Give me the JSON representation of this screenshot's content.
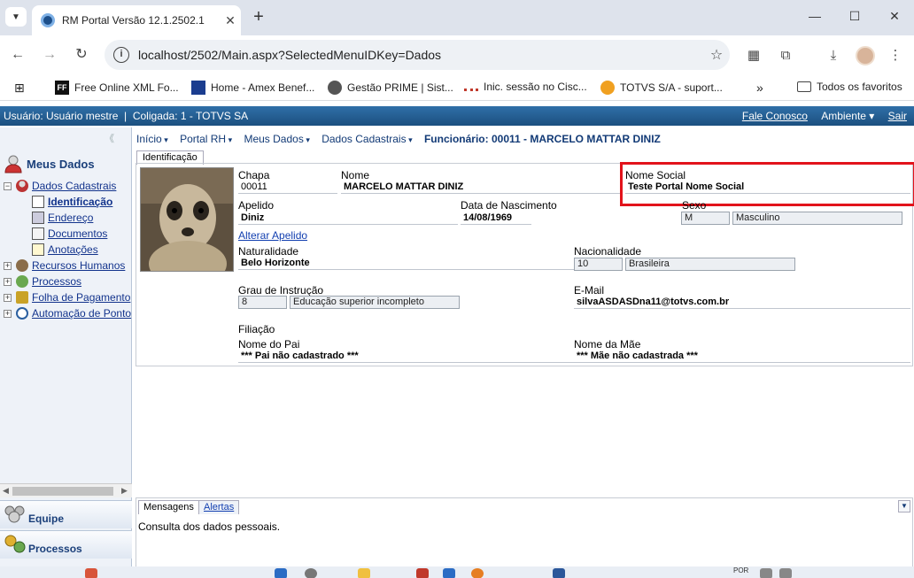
{
  "browser": {
    "tab_title": "RM Portal Versão 12.1.2502.1",
    "tab_close": "✕",
    "new_tab": "+",
    "window_controls": {
      "minimize": "—",
      "maximize": "☐",
      "close": "✕"
    },
    "nav": {
      "back": "←",
      "forward": "→",
      "reload": "↻"
    },
    "url": "localhost/2502/Main.aspx?SelectedMenuIDKey=Dados",
    "bookmarks": [
      {
        "label": "Free Online XML Fo...",
        "icon": "ff-icon"
      },
      {
        "label": "Home - Amex Benef...",
        "icon": "amex-icon"
      },
      {
        "label": "Gestão PRIME | Sist...",
        "icon": "prime-icon"
      },
      {
        "label": "Inic. sessão no Cisc...",
        "icon": "cisco-icon"
      },
      {
        "label": "TOTVS S/A - suport...",
        "icon": "totvs-icon"
      }
    ],
    "bookmarks_overflow": "»",
    "all_bookmarks": "Todos os favoritos"
  },
  "portal": {
    "topbar": {
      "user": "Usuário: Usuário mestre",
      "separator": "|",
      "coligada": "Coligada: 1 - TOTVS SA",
      "contact": "Fale Conosco",
      "environment": "Ambiente ▾",
      "logout": "Sair"
    },
    "sidebar": {
      "collapse": "《",
      "header": "Meus Dados",
      "tree": [
        {
          "label": "Dados Cadastrais",
          "level": 0,
          "expander": "−"
        },
        {
          "label": "Identificação",
          "level": 1,
          "selected": true
        },
        {
          "label": "Endereço",
          "level": 1
        },
        {
          "label": "Documentos",
          "level": 1
        },
        {
          "label": "Anotações",
          "level": 1
        },
        {
          "label": "Recursos Humanos",
          "level": 0,
          "expander": "+"
        },
        {
          "label": "Processos",
          "level": 0,
          "expander": "+"
        },
        {
          "label": "Folha de Pagamento",
          "level": 0,
          "expander": "+"
        },
        {
          "label": "Automação de Ponto",
          "level": 0,
          "expander": "+"
        }
      ],
      "panels": [
        "Equipe",
        "Processos"
      ]
    },
    "breadcrumb": {
      "items": [
        "Início",
        "Portal RH",
        "Meus Dados",
        "Dados Cadastrais"
      ],
      "current": "Funcionário: 00011 - MARCELO MATTAR DINIZ"
    },
    "tab": "Identificação",
    "form": {
      "chapa_label": "Chapa",
      "chapa": "00011",
      "nome_label": "Nome",
      "nome": "MARCELO MATTAR DINIZ",
      "nome_social_label": "Nome Social",
      "nome_social": "Teste Portal Nome Social",
      "apelido_label": "Apelido",
      "apelido": "Diniz",
      "nascimento_label": "Data de Nascimento",
      "nascimento": "14/08/1969",
      "sexo_label": "Sexo",
      "sexo_code": "M",
      "sexo": "Masculino",
      "alterar_apelido": "Alterar Apelido",
      "naturalidade_label": "Naturalidade",
      "naturalidade": "Belo Horizonte",
      "nacionalidade_label": "Nacionalidade",
      "nacionalidade_code": "10",
      "nacionalidade": "Brasileira",
      "instrucao_label": "Grau de Instrução",
      "instrucao_code": "8",
      "instrucao": "Educação superior incompleto",
      "email_label": "E-Mail",
      "email": "silvaASDASDna11@totvs.com.br",
      "filiacao_label": "Filiação",
      "pai_label": "Nome do Pai",
      "pai": "*** Pai não cadastrado ***",
      "mae_label": "Nome da Mãe",
      "mae": "*** Mãe não cadastrada ***"
    },
    "bottom": {
      "tabs": [
        "Mensagens",
        "Alertas"
      ],
      "message": "Consulta dos dados pessoais.",
      "dropdown": "▼"
    }
  },
  "taskbar": {
    "lang": "POR"
  },
  "colors": {
    "topbar": "#1c507f",
    "link": "#123fb0",
    "highlight": "#e2131b"
  }
}
